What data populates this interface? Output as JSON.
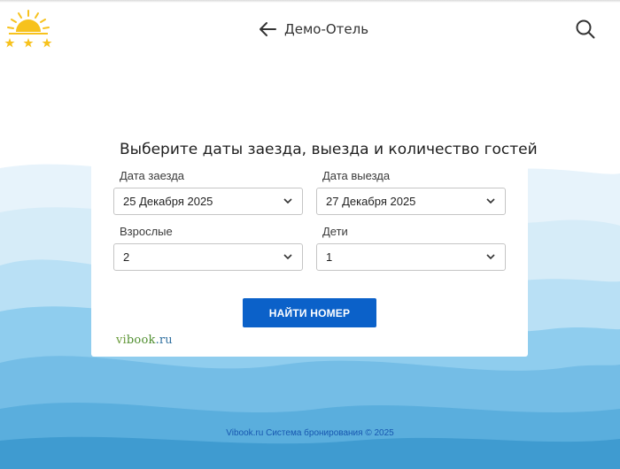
{
  "header": {
    "hotel_name": "Демо-Отель",
    "back_icon": "arrow-left-icon",
    "search_icon": "search-icon",
    "logo_icon": "sun-three-stars-logo"
  },
  "booking": {
    "title": "Выберите даты заезда, выезда и количество гостей",
    "checkin": {
      "label": "Дата заезда",
      "value": "25 Декабря 2025"
    },
    "checkout": {
      "label": "Дата выезда",
      "value": "27 Декабря 2025"
    },
    "adults": {
      "label": "Взрослые",
      "value": "2"
    },
    "children": {
      "label": "Дети",
      "value": "1"
    },
    "submit_label": "НАЙТИ НОМЕР",
    "brand": {
      "vi": "vi",
      "book": "book",
      "ru": ".ru"
    }
  },
  "footer": {
    "text": "Vibook.ru Система бронирования © 2025"
  },
  "colors": {
    "accent": "#0b61c9",
    "wave_light": "#e4f2fb",
    "wave_mid": "#a9d7f2",
    "wave_deep": "#4fa6d6",
    "sun": "#f7c21d"
  }
}
